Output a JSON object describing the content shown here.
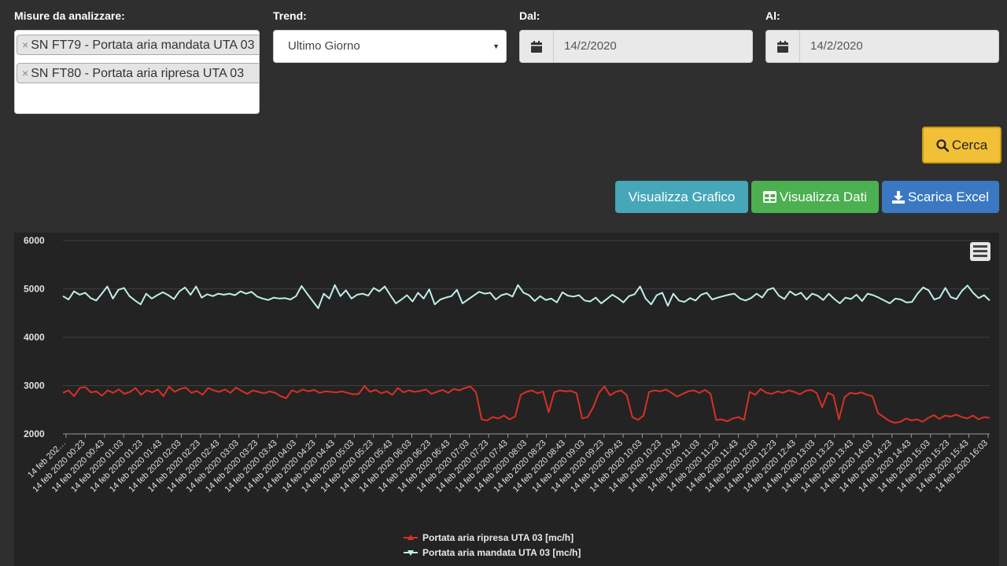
{
  "filters": {
    "measures_label": "Misure da analizzare:",
    "selected_measures": [
      "SN FT79 - Portata aria mandata UTA 03",
      "SN FT80 - Portata aria ripresa UTA 03"
    ],
    "trend_label": "Trend:",
    "trend_value": "Ultimo Giorno",
    "from_label": "Dal:",
    "from_value": "14/2/2020",
    "to_label": "Al:",
    "to_value": "14/2/2020"
  },
  "actions": {
    "search_label": "Cerca",
    "show_chart_label": "Visualizza Grafico",
    "show_data_label": "Visualizza Dati",
    "download_excel_label": "Scarica Excel"
  },
  "colors": {
    "background": "#2f2f2f",
    "chart_background": "#232323",
    "search_button": "#f2c037",
    "chart_button": "#46a7b8",
    "data_button": "#4caf50",
    "excel_button": "#3a78c2",
    "series_ripresa": "#d93025",
    "series_mandata": "#bfeee8"
  },
  "icons": [
    "remove-tag-icon",
    "dropdown-caret-icon",
    "calendar-icon",
    "search-icon",
    "table-icon",
    "download-icon",
    "hamburger-menu-icon"
  ],
  "chart_data": {
    "type": "line",
    "ylim": [
      2000,
      6000
    ],
    "yticks": [
      2000,
      3000,
      4000,
      5000,
      6000
    ],
    "grid": true,
    "legend_position": "bottom-center",
    "x_tick_labels": [
      "14 feb 202…",
      "14 feb 2020 00:23",
      "14 feb 2020 00:43",
      "14 feb 2020 01:03",
      "14 feb 2020 01:23",
      "14 feb 2020 01:43",
      "14 feb 2020 02:03",
      "14 feb 2020 02:23",
      "14 feb 2020 02:43",
      "14 feb 2020 03:03",
      "14 feb 2020 03:23",
      "14 feb 2020 03:43",
      "14 feb 2020 04:03",
      "14 feb 2020 04:23",
      "14 feb 2020 04:43",
      "14 feb 2020 05:03",
      "14 feb 2020 05:23",
      "14 feb 2020 05:43",
      "14 feb 2020 06:03",
      "14 feb 2020 06:23",
      "14 feb 2020 06:43",
      "14 feb 2020 07:03",
      "14 feb 2020 07:23",
      "14 feb 2020 07:43",
      "14 feb 2020 08:03",
      "14 feb 2020 08:23",
      "14 feb 2020 08:43",
      "14 feb 2020 09:03",
      "14 feb 2020 09:23",
      "14 feb 2020 09:43",
      "14 feb 2020 10:03",
      "14 feb 2020 10:23",
      "14 feb 2020 10:43",
      "14 feb 2020 11:03",
      "14 feb 2020 11:23",
      "14 feb 2020 11:43",
      "14 feb 2020 12:03",
      "14 feb 2020 12:23",
      "14 feb 2020 12:43",
      "14 feb 2020 13:03",
      "14 feb 2020 13:23",
      "14 feb 2020 13:43",
      "14 feb 2020 14:03",
      "14 feb 2020 14:23",
      "14 feb 2020 14:43",
      "14 feb 2020 15:03",
      "14 feb 2020 15:23",
      "14 feb 2020 15:43",
      "14 feb 2020 16:03"
    ],
    "series": [
      {
        "name": "Portata aria ripresa UTA 03 [mc/h]",
        "color": "#d93025",
        "values": [
          2850,
          2900,
          2780,
          2950,
          2970,
          2860,
          2880,
          2790,
          2900,
          2850,
          2920,
          2830,
          2870,
          2950,
          2810,
          2900,
          2860,
          2920,
          2780,
          2980,
          2870,
          2930,
          2960,
          2850,
          2890,
          2810,
          2950,
          2900,
          2870,
          2920,
          2850,
          2960,
          2890,
          2830,
          2900,
          2870,
          2840,
          2880,
          2850,
          2780,
          2740,
          2900,
          2860,
          2920,
          2880,
          2910,
          2850,
          2880,
          2870,
          2860,
          2880,
          2850,
          2820,
          2830,
          2990,
          2870,
          2910,
          2840,
          2880,
          2810,
          2950,
          2860,
          2900,
          2870,
          2890,
          2920,
          2830,
          2870,
          2910,
          2850,
          2930,
          2900,
          2950,
          2980,
          2860,
          2300,
          2280,
          2350,
          2320,
          2380,
          2300,
          2360,
          2810,
          2870,
          2900,
          2840,
          2880,
          2450,
          2860,
          2900,
          2880,
          2890,
          2840,
          2320,
          2350,
          2560,
          2850,
          2980,
          2800,
          2870,
          2900,
          2800,
          2350,
          2290,
          2380,
          2870,
          2900,
          2880,
          2920,
          2850,
          2770,
          2830,
          2880,
          2900,
          2850,
          2910,
          2830,
          2290,
          2300,
          2260,
          2320,
          2350,
          2290,
          2870,
          2810,
          2930,
          2850,
          2830,
          2880,
          2850,
          2900,
          2870,
          2820,
          2890,
          2910,
          2850,
          2550,
          2850,
          2800,
          2300,
          2760,
          2850,
          2830,
          2860,
          2810,
          2780,
          2430,
          2350,
          2270,
          2230,
          2250,
          2320,
          2280,
          2300,
          2250,
          2330,
          2390,
          2310,
          2380,
          2360,
          2400,
          2350,
          2320,
          2380,
          2300,
          2350,
          2330
        ]
      },
      {
        "name": "Portata aria mandata UTA 03 [mc/h]",
        "color": "#bfeee8",
        "values": [
          4850,
          4780,
          4950,
          4880,
          4920,
          4810,
          4760,
          4900,
          5050,
          4800,
          4980,
          5020,
          4850,
          4760,
          4680,
          4900,
          4800,
          4870,
          4930,
          4870,
          4790,
          4950,
          5030,
          4880,
          5050,
          4820,
          4890,
          4850,
          4900,
          4880,
          4900,
          4870,
          4950,
          4900,
          4940,
          4840,
          4800,
          4770,
          4820,
          4800,
          4810,
          4780,
          4850,
          5060,
          4900,
          4750,
          4600,
          4900,
          4800,
          5080,
          4850,
          4970,
          4800,
          4880,
          4900,
          4860,
          5020,
          4950,
          5050,
          4870,
          4700,
          4780,
          4870,
          4740,
          4920,
          4800,
          4990,
          4680,
          4780,
          4820,
          4850,
          4980,
          4700,
          4780,
          4860,
          4940,
          4900,
          4920,
          4780,
          4870,
          4900,
          4840,
          5080,
          4920,
          4870,
          4750,
          4850,
          4770,
          4800,
          4720,
          4930,
          4860,
          4840,
          4870,
          4760,
          4740,
          4820,
          4700,
          4790,
          4880,
          4810,
          4720,
          4850,
          4890,
          5050,
          4800,
          4680,
          4870,
          4920,
          4650,
          4900,
          4760,
          4730,
          4810,
          4760,
          4880,
          4920,
          4780,
          4820,
          4850,
          4880,
          4900,
          4800,
          4760,
          4810,
          4900,
          4820,
          4980,
          5020,
          4860,
          4790,
          4950,
          4870,
          4920,
          4780,
          4900,
          4860,
          4770,
          4900,
          4790,
          4700,
          4820,
          4790,
          4880,
          4750,
          4900,
          4870,
          4820,
          4760,
          4700,
          4800,
          4780,
          4720,
          4730,
          4900,
          5030,
          4970,
          4780,
          4820,
          5020,
          4830,
          4790,
          4960,
          5070,
          4920,
          4810,
          4870,
          4760
        ]
      }
    ]
  }
}
